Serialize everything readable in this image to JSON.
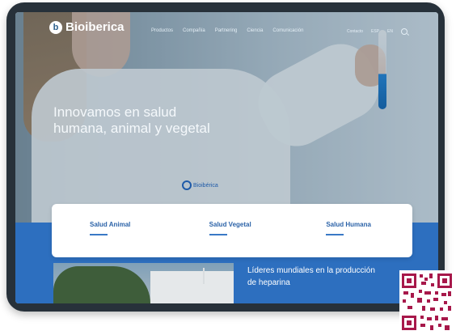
{
  "brand": {
    "name": "Bioiberica",
    "logo_letter": "b"
  },
  "nav": {
    "items": [
      "Productos",
      "Compañía",
      "Partnering",
      "Ciencia",
      "Comunicación"
    ],
    "right": [
      "Contacto",
      "ESP",
      "EN"
    ]
  },
  "hero": {
    "headline_line1": "Innovamos en salud",
    "headline_line2": "humana, animal y vegetal",
    "badge": "Bioibérica"
  },
  "cards": [
    "Salud Animal",
    "Salud Vegetal",
    "Salud Humana"
  ],
  "feature": {
    "title_line1": "Líderes mundiales en la producción",
    "title_line2": "de heparina"
  },
  "colors": {
    "accent": "#2d6fbf",
    "card_text": "#2c63a8",
    "tablet_frame": "#27313a"
  }
}
